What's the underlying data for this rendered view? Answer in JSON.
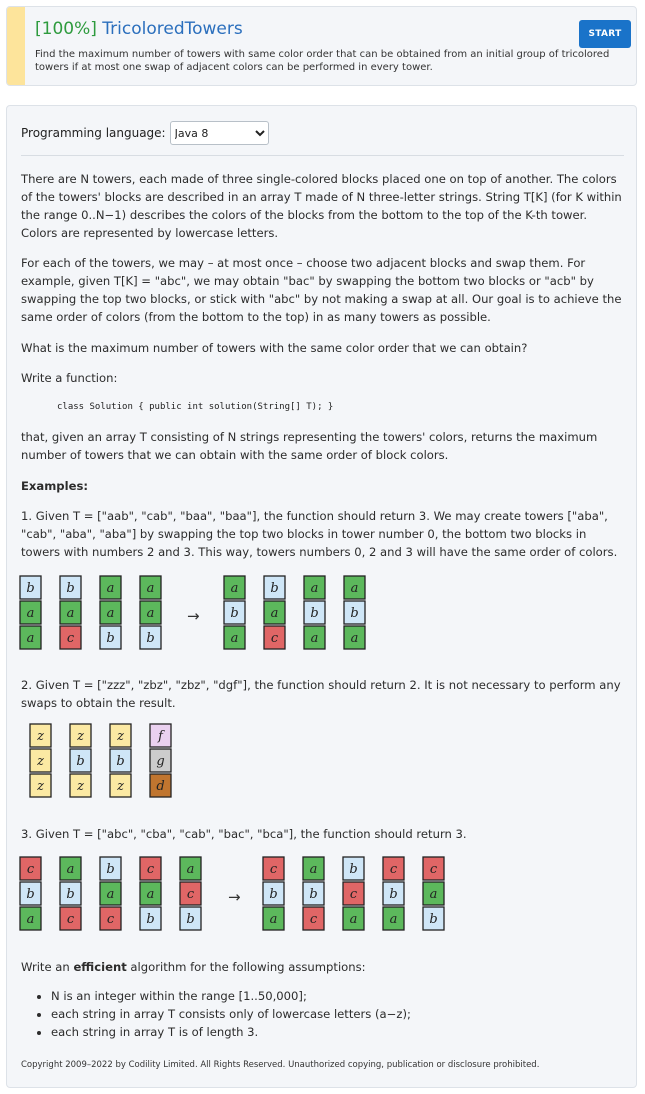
{
  "task": {
    "score": "[100%]",
    "name": "TricoloredTowers",
    "description": "Find the maximum number of towers with same color order that can be obtained from an initial group of tricolored towers if at most one swap of adjacent colors can be performed in every tower.",
    "start_label": "START"
  },
  "language": {
    "label": "Programming language:",
    "selected": "Java 8"
  },
  "statement": {
    "p1": "There are N towers, each made of three single-colored blocks placed one on top of another. The colors of the towers' blocks are described in an array T made of N three-letter strings. String T[K] (for K within the range 0..N−1) describes the colors of the blocks from the bottom to the top of the K-th tower. Colors are represented by lowercase letters.",
    "p2": "For each of the towers, we may – at most once – choose two adjacent blocks and swap them. For example, given T[K] = \"abc\", we may obtain \"bac\" by swapping the bottom two blocks or \"acb\" by swapping the top two blocks, or stick with \"abc\" by not making a swap at all. Our goal is to achieve the same order of colors (from the bottom to the top) in as many towers as possible.",
    "p3": "What is the maximum number of towers with the same color order that we can obtain?",
    "p4": "Write a function:",
    "code": "class Solution { public int solution(String[] T); }",
    "p5": "that, given an array T consisting of N strings representing the towers' colors, returns the maximum number of towers that we can obtain with the same order of block colors.",
    "examples_label": "Examples:",
    "ex1": "1. Given T = [\"aab\", \"cab\", \"baa\", \"baa\"], the function should return 3. We may create towers [\"aba\", \"cab\", \"aba\", \"aba\"] by swapping the top two blocks in tower number 0, the bottom two blocks in towers with numbers 2 and 3. This way, towers numbers 0, 2 and 3 will have the same order of colors.",
    "ex2": "2. Given T = [\"zzz\", \"zbz\", \"zbz\", \"dgf\"], the function should return 2. It is not necessary to perform any swaps to obtain the result.",
    "ex3": "3. Given T = [\"abc\", \"cba\", \"cab\", \"bac\", \"bca\"], the function should return 3.",
    "efficient_pre": "Write an ",
    "efficient_word": "efficient",
    "efficient_post": " algorithm for the following assumptions:",
    "assumptions": [
      "N is an integer within the range [1..50,000];",
      "each string in array T consists only of lowercase letters (a−z);",
      "each string in array T is of length 3."
    ],
    "copyright": "Copyright 2009–2022 by Codility Limited. All Rights Reserved. Unauthorized copying, publication or disclosure prohibited."
  },
  "colors": {
    "a": "#5cb85c",
    "b": "#cfe6f7",
    "c": "#e06666",
    "z": "#fbe9a3",
    "f": "#ead1f0",
    "g": "#cccccc",
    "d": "#c0752f"
  },
  "arrow": "→",
  "figures": {
    "fig1": {
      "before": [
        "aab",
        "cab",
        "baa",
        "baa"
      ],
      "after": [
        "aba",
        "cab",
        "aba",
        "aba"
      ]
    },
    "fig2": {
      "before": [
        "zzz",
        "zbz",
        "zbz",
        "dgf"
      ]
    },
    "fig3": {
      "before": [
        "abc",
        "cba",
        "cab",
        "bac",
        "bca"
      ],
      "after": [
        "abc",
        "cba",
        "acb",
        "abc",
        "bac"
      ]
    }
  }
}
